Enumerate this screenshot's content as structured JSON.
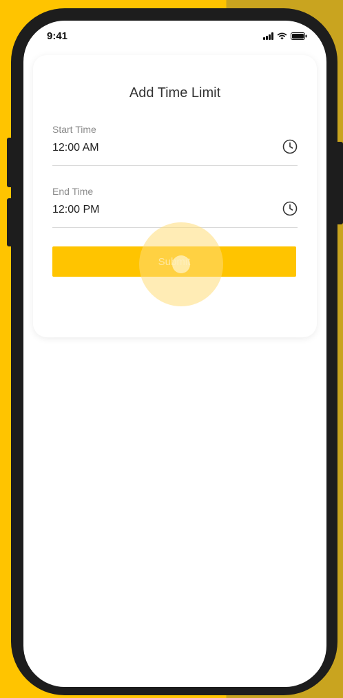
{
  "status_bar": {
    "time": "9:41",
    "icons": [
      "signal-icon",
      "wifi-icon",
      "battery-icon"
    ]
  },
  "dialog": {
    "title": "Add Time Limit",
    "start_time": {
      "label": "Start Time",
      "value": "12:00 AM",
      "icon": "clock-icon"
    },
    "end_time": {
      "label": "End Time",
      "value": "12:00 PM",
      "icon": "clock-icon"
    },
    "submit_label": "Submit"
  },
  "colors": {
    "accent": "#FFC400",
    "background_dark_accent": "#C9A41F",
    "phone_frame": "#1D1D1D"
  }
}
